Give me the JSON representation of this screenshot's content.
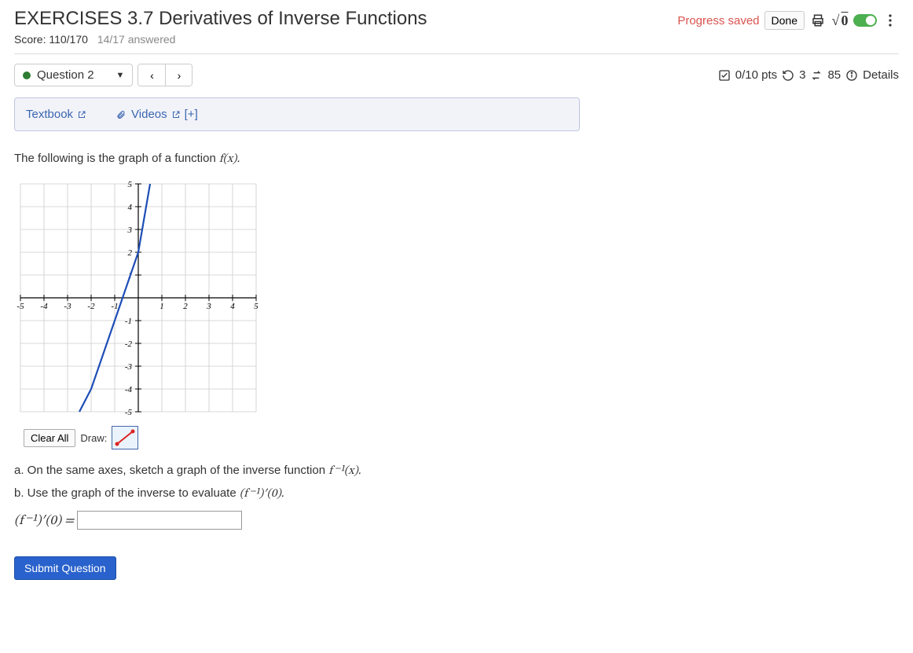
{
  "header": {
    "title": "EXERCISES 3.7 Derivatives of Inverse Functions",
    "score_label": "Score: 110/170",
    "answered_label": "14/17 answered",
    "progress_saved": "Progress saved",
    "done_label": "Done"
  },
  "question_bar": {
    "question_label": "Question 2",
    "points": "0/10 pts",
    "attempts_remaining": "3",
    "attempts_total": "85",
    "details": "Details"
  },
  "resources": {
    "textbook": "Textbook",
    "videos": "Videos",
    "more": "[+]"
  },
  "body": {
    "intro": "The following is the graph of a function ",
    "intro_fn": "f(x).",
    "clear_all": "Clear All",
    "draw_label": "Draw:",
    "part_a": "a. On the same axes, sketch a graph of the inverse function ",
    "part_a_fn": "f ⁻¹(x).",
    "part_b": "b. Use the graph of the inverse to evaluate ",
    "part_b_fn": "(f ⁻¹)′(0).",
    "answer_lhs": "(f ⁻¹)′(0) =",
    "submit": "Submit Question"
  },
  "chart_data": {
    "type": "line",
    "title": "",
    "xlabel": "",
    "ylabel": "",
    "xlim": [
      -5,
      5
    ],
    "ylim": [
      -5,
      5
    ],
    "x_ticks": [
      -5,
      -4,
      -3,
      -2,
      -1,
      1,
      2,
      3,
      4,
      5
    ],
    "y_ticks": [
      -5,
      -4,
      -3,
      -2,
      -1,
      1,
      2,
      3,
      4,
      5
    ],
    "series": [
      {
        "name": "f(x)",
        "color": "#1e4db7",
        "x": [
          -2.5,
          -2,
          -1,
          0,
          0.5
        ],
        "values": [
          -5,
          -4,
          -1,
          2,
          5
        ]
      }
    ]
  }
}
